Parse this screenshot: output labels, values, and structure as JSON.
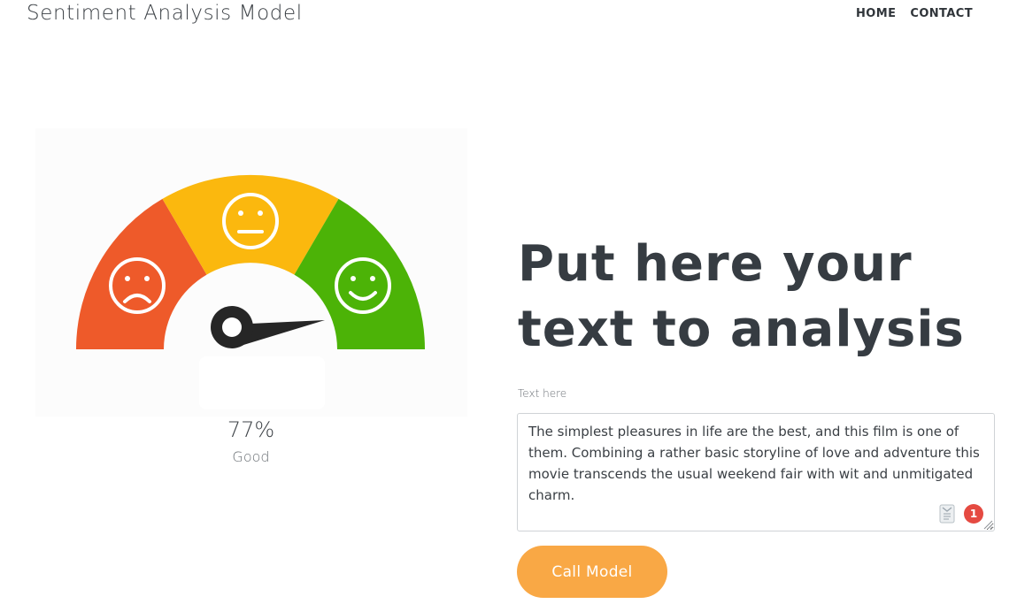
{
  "header": {
    "brand": "Sentiment Analysis Model",
    "nav": [
      {
        "label": "HOME"
      },
      {
        "label": "CONTACT"
      }
    ]
  },
  "gauge": {
    "level_percent": 77,
    "value_text": "77%",
    "sentiment_label": "Good",
    "colors": {
      "sad": "#ee5a2a",
      "neutral": "#fbb80e",
      "happy": "#4cb307",
      "needle": "#262626"
    },
    "icons": [
      "sad-face-icon",
      "neutral-face-icon",
      "happy-face-icon"
    ]
  },
  "main": {
    "headline": "Put here your text to analysis",
    "field_label": "Text here",
    "text_value": "The simplest pleasures in life are the best, and this film is one of them. Combining a rather basic storyline of love and adventure this movie transcends the usual weekend fair with wit and unmitigated charm.",
    "grammar_badge_count": "1",
    "button_label": "Call Model",
    "button_color": "#f9a845"
  }
}
